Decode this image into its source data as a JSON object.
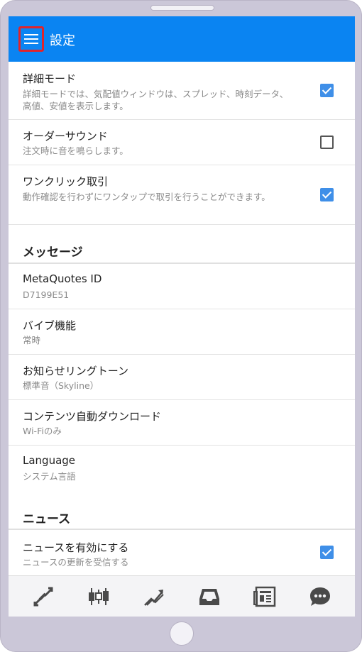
{
  "header": {
    "title": "設定"
  },
  "settings": [
    {
      "title": "詳細モード",
      "sub": "詳細モードでは、気配値ウィンドウは、スプレッド、時刻データ、高値、安値を表示します。",
      "checked": true
    },
    {
      "title": "オーダーサウンド",
      "sub": "注文時に音を鳴らします。",
      "checked": false
    },
    {
      "title": "ワンクリック取引",
      "sub": "動作確認を行わずにワンタップで取引を行うことができます。",
      "checked": true
    }
  ],
  "messages": {
    "heading": "メッセージ",
    "items": [
      {
        "title": "MetaQuotes ID",
        "sub": "D7199E51"
      },
      {
        "title": "バイブ機能",
        "sub": "常時"
      },
      {
        "title": "お知らせリングトーン",
        "sub": "標準音（Skyline）"
      },
      {
        "title": "コンテンツ自動ダウンロード",
        "sub": "Wi-Fiのみ"
      },
      {
        "title": "Language",
        "sub": "システム言語"
      }
    ]
  },
  "news": {
    "heading": "ニュース",
    "item": {
      "title": "ニュースを有効にする",
      "sub": "ニュースの更新を受信する",
      "checked": true
    }
  },
  "tabs": [
    "quotes-icon",
    "chart-icon",
    "trade-icon",
    "history-icon",
    "news-icon",
    "chat-icon"
  ],
  "colors": {
    "appbar": "#0a84f2",
    "highlight": "#e0242b",
    "checkbox": "#3f8fe8"
  }
}
